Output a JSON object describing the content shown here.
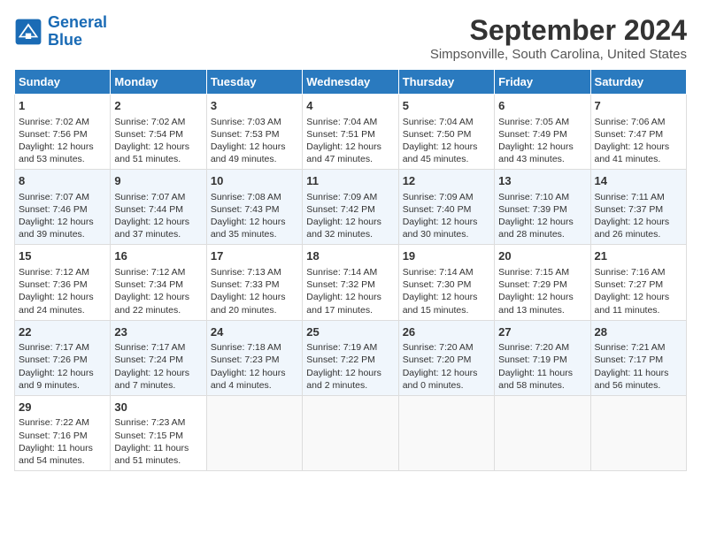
{
  "header": {
    "logo_line1": "General",
    "logo_line2": "Blue",
    "title": "September 2024",
    "subtitle": "Simpsonville, South Carolina, United States"
  },
  "days_of_week": [
    "Sunday",
    "Monday",
    "Tuesday",
    "Wednesday",
    "Thursday",
    "Friday",
    "Saturday"
  ],
  "weeks": [
    [
      {
        "day": "1",
        "lines": [
          "Sunrise: 7:02 AM",
          "Sunset: 7:56 PM",
          "Daylight: 12 hours",
          "and 53 minutes."
        ]
      },
      {
        "day": "2",
        "lines": [
          "Sunrise: 7:02 AM",
          "Sunset: 7:54 PM",
          "Daylight: 12 hours",
          "and 51 minutes."
        ]
      },
      {
        "day": "3",
        "lines": [
          "Sunrise: 7:03 AM",
          "Sunset: 7:53 PM",
          "Daylight: 12 hours",
          "and 49 minutes."
        ]
      },
      {
        "day": "4",
        "lines": [
          "Sunrise: 7:04 AM",
          "Sunset: 7:51 PM",
          "Daylight: 12 hours",
          "and 47 minutes."
        ]
      },
      {
        "day": "5",
        "lines": [
          "Sunrise: 7:04 AM",
          "Sunset: 7:50 PM",
          "Daylight: 12 hours",
          "and 45 minutes."
        ]
      },
      {
        "day": "6",
        "lines": [
          "Sunrise: 7:05 AM",
          "Sunset: 7:49 PM",
          "Daylight: 12 hours",
          "and 43 minutes."
        ]
      },
      {
        "day": "7",
        "lines": [
          "Sunrise: 7:06 AM",
          "Sunset: 7:47 PM",
          "Daylight: 12 hours",
          "and 41 minutes."
        ]
      }
    ],
    [
      {
        "day": "8",
        "lines": [
          "Sunrise: 7:07 AM",
          "Sunset: 7:46 PM",
          "Daylight: 12 hours",
          "and 39 minutes."
        ]
      },
      {
        "day": "9",
        "lines": [
          "Sunrise: 7:07 AM",
          "Sunset: 7:44 PM",
          "Daylight: 12 hours",
          "and 37 minutes."
        ]
      },
      {
        "day": "10",
        "lines": [
          "Sunrise: 7:08 AM",
          "Sunset: 7:43 PM",
          "Daylight: 12 hours",
          "and 35 minutes."
        ]
      },
      {
        "day": "11",
        "lines": [
          "Sunrise: 7:09 AM",
          "Sunset: 7:42 PM",
          "Daylight: 12 hours",
          "and 32 minutes."
        ]
      },
      {
        "day": "12",
        "lines": [
          "Sunrise: 7:09 AM",
          "Sunset: 7:40 PM",
          "Daylight: 12 hours",
          "and 30 minutes."
        ]
      },
      {
        "day": "13",
        "lines": [
          "Sunrise: 7:10 AM",
          "Sunset: 7:39 PM",
          "Daylight: 12 hours",
          "and 28 minutes."
        ]
      },
      {
        "day": "14",
        "lines": [
          "Sunrise: 7:11 AM",
          "Sunset: 7:37 PM",
          "Daylight: 12 hours",
          "and 26 minutes."
        ]
      }
    ],
    [
      {
        "day": "15",
        "lines": [
          "Sunrise: 7:12 AM",
          "Sunset: 7:36 PM",
          "Daylight: 12 hours",
          "and 24 minutes."
        ]
      },
      {
        "day": "16",
        "lines": [
          "Sunrise: 7:12 AM",
          "Sunset: 7:34 PM",
          "Daylight: 12 hours",
          "and 22 minutes."
        ]
      },
      {
        "day": "17",
        "lines": [
          "Sunrise: 7:13 AM",
          "Sunset: 7:33 PM",
          "Daylight: 12 hours",
          "and 20 minutes."
        ]
      },
      {
        "day": "18",
        "lines": [
          "Sunrise: 7:14 AM",
          "Sunset: 7:32 PM",
          "Daylight: 12 hours",
          "and 17 minutes."
        ]
      },
      {
        "day": "19",
        "lines": [
          "Sunrise: 7:14 AM",
          "Sunset: 7:30 PM",
          "Daylight: 12 hours",
          "and 15 minutes."
        ]
      },
      {
        "day": "20",
        "lines": [
          "Sunrise: 7:15 AM",
          "Sunset: 7:29 PM",
          "Daylight: 12 hours",
          "and 13 minutes."
        ]
      },
      {
        "day": "21",
        "lines": [
          "Sunrise: 7:16 AM",
          "Sunset: 7:27 PM",
          "Daylight: 12 hours",
          "and 11 minutes."
        ]
      }
    ],
    [
      {
        "day": "22",
        "lines": [
          "Sunrise: 7:17 AM",
          "Sunset: 7:26 PM",
          "Daylight: 12 hours",
          "and 9 minutes."
        ]
      },
      {
        "day": "23",
        "lines": [
          "Sunrise: 7:17 AM",
          "Sunset: 7:24 PM",
          "Daylight: 12 hours",
          "and 7 minutes."
        ]
      },
      {
        "day": "24",
        "lines": [
          "Sunrise: 7:18 AM",
          "Sunset: 7:23 PM",
          "Daylight: 12 hours",
          "and 4 minutes."
        ]
      },
      {
        "day": "25",
        "lines": [
          "Sunrise: 7:19 AM",
          "Sunset: 7:22 PM",
          "Daylight: 12 hours",
          "and 2 minutes."
        ]
      },
      {
        "day": "26",
        "lines": [
          "Sunrise: 7:20 AM",
          "Sunset: 7:20 PM",
          "Daylight: 12 hours",
          "and 0 minutes."
        ]
      },
      {
        "day": "27",
        "lines": [
          "Sunrise: 7:20 AM",
          "Sunset: 7:19 PM",
          "Daylight: 11 hours",
          "and 58 minutes."
        ]
      },
      {
        "day": "28",
        "lines": [
          "Sunrise: 7:21 AM",
          "Sunset: 7:17 PM",
          "Daylight: 11 hours",
          "and 56 minutes."
        ]
      }
    ],
    [
      {
        "day": "29",
        "lines": [
          "Sunrise: 7:22 AM",
          "Sunset: 7:16 PM",
          "Daylight: 11 hours",
          "and 54 minutes."
        ]
      },
      {
        "day": "30",
        "lines": [
          "Sunrise: 7:23 AM",
          "Sunset: 7:15 PM",
          "Daylight: 11 hours",
          "and 51 minutes."
        ]
      },
      null,
      null,
      null,
      null,
      null
    ]
  ]
}
